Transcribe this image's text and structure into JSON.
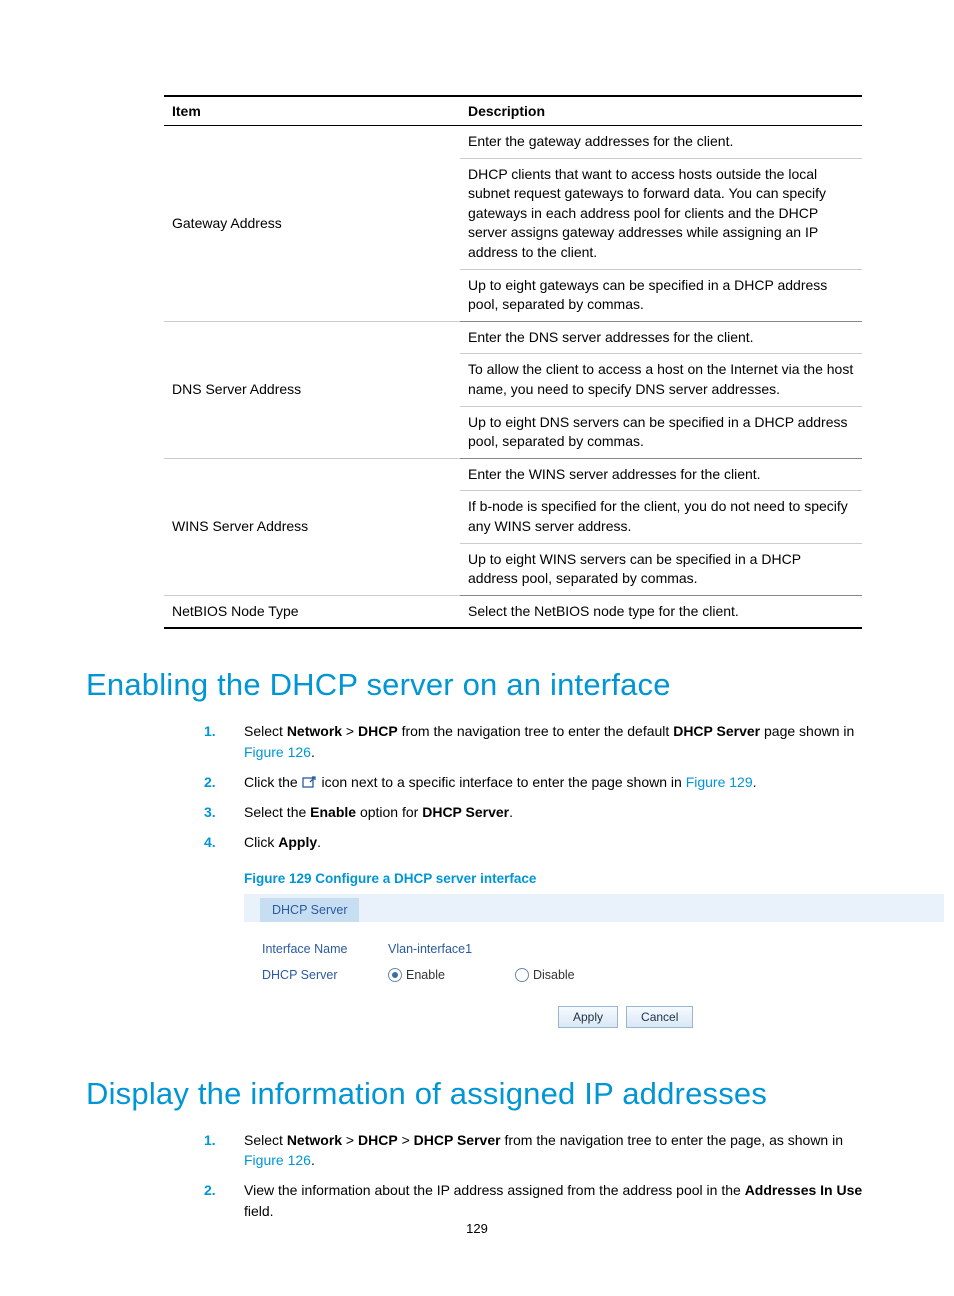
{
  "table": {
    "header_item": "Item",
    "header_desc": "Description",
    "rows": [
      {
        "item": "Gateway Address",
        "desc": [
          "Enter the gateway addresses for the client.",
          "DHCP clients that want to access hosts outside the local subnet request gateways to forward data. You can specify gateways in each address pool for clients and the DHCP server assigns gateway addresses while assigning an IP address to the client.",
          "Up to eight gateways can be specified in a DHCP address pool, separated by commas."
        ]
      },
      {
        "item": "DNS Server Address",
        "desc": [
          "Enter the DNS server addresses for the client.",
          "To allow the client to access a host on the Internet via the host name, you need to specify DNS server addresses.",
          "Up to eight DNS servers can be specified in a DHCP address pool, separated by commas."
        ]
      },
      {
        "item": "WINS Server Address",
        "desc": [
          "Enter the WINS server addresses for the client.",
          "If b-node is specified for the client, you do not need to specify any WINS server address.",
          "Up to eight WINS servers can be specified in a DHCP address pool, separated by commas."
        ]
      },
      {
        "item": "NetBIOS Node Type",
        "desc": [
          "Select the NetBIOS node type for the client."
        ]
      }
    ]
  },
  "section1": {
    "title": "Enabling the DHCP server on an interface",
    "steps": {
      "s1a": "Select ",
      "s1_network": "Network",
      "s1_gt1": " > ",
      "s1_dhcp": "DHCP",
      "s1b": " from the navigation tree to enter the default ",
      "s1_dhcpserver": "DHCP Server",
      "s1c": " page shown in ",
      "s1_fig126": "Figure 126",
      "s1d": ".",
      "s2a": "Click the ",
      "s2b": " icon next to a specific interface to enter the page shown in ",
      "s2_fig129": "Figure 129",
      "s2c": ".",
      "s3a": "Select the ",
      "s3_enable": "Enable",
      "s3b": " option for ",
      "s3_dhcpserver": "DHCP Server",
      "s3c": ".",
      "s4a": "Click ",
      "s4_apply": "Apply",
      "s4b": "."
    },
    "figure_caption": "Figure 129 Configure a DHCP server interface",
    "figure": {
      "tab": "DHCP Server",
      "row1_label": "Interface Name",
      "row1_value": "Vlan-interface1",
      "row2_label": "DHCP Server",
      "radio_enable": "Enable",
      "radio_disable": "Disable",
      "btn_apply": "Apply",
      "btn_cancel": "Cancel"
    }
  },
  "section2": {
    "title": "Display the information of assigned IP addresses",
    "steps": {
      "s1a": "Select ",
      "s1_network": "Network",
      "s1_gt1": " > ",
      "s1_dhcp": "DHCP",
      "s1_gt2": " > ",
      "s1_dhcpserver": "DHCP Server",
      "s1b": " from the navigation tree to enter the page, as shown in ",
      "s1_fig126": "Figure 126",
      "s1c": ".",
      "s2a": "View the information about the IP address assigned from the address pool in the ",
      "s2_addresses": "Addresses In Use",
      "s2b": " field."
    }
  },
  "page_number": "129"
}
